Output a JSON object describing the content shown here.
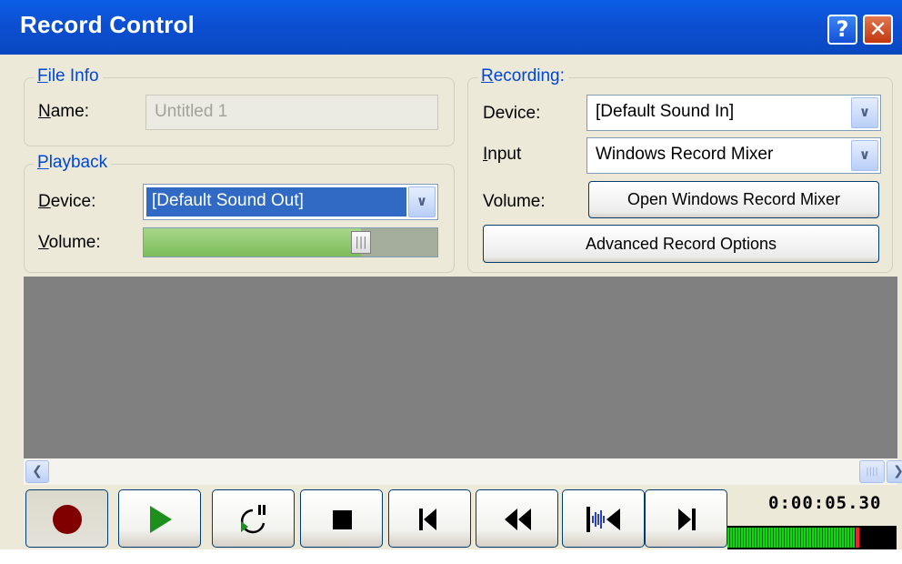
{
  "window": {
    "title": "Record Control",
    "help_button": "?",
    "close_button": "✕"
  },
  "file_info": {
    "legend": "File Info",
    "name_label": "Name:",
    "name_value": "Untitled 1"
  },
  "playback": {
    "legend": "Playback",
    "device_label": "Device:",
    "device_value": "[Default Sound Out]",
    "volume_label": "Volume:",
    "volume_level": 0.74
  },
  "recording": {
    "legend": "Recording:",
    "device_label": "Device:",
    "device_value": "[Default Sound In]",
    "input_label": "Input",
    "input_value": "Windows Record Mixer",
    "volume_label": "Volume:",
    "open_mixer_button": "Open Windows Record Mixer",
    "advanced_button": "Advanced Record Options"
  },
  "transport": {
    "buttons": [
      "record",
      "play",
      "loop-play",
      "stop",
      "go-to-start",
      "rewind",
      "trim",
      "go-to-end"
    ],
    "time": "0:00:05.30",
    "level": 0.75,
    "peak": 0.76
  },
  "colors": {
    "title_bar": "#0a5fe6",
    "dialog_bg": "#ece9d8",
    "group_legend": "#0046d5",
    "record": "#800000",
    "play": "#1d8f1d"
  },
  "icons": {
    "help": "help-icon",
    "close": "close-icon",
    "dropdown": "chevron-down-icon",
    "scroll_left": "arrow-left-icon",
    "scroll_right": "arrow-right-icon"
  }
}
